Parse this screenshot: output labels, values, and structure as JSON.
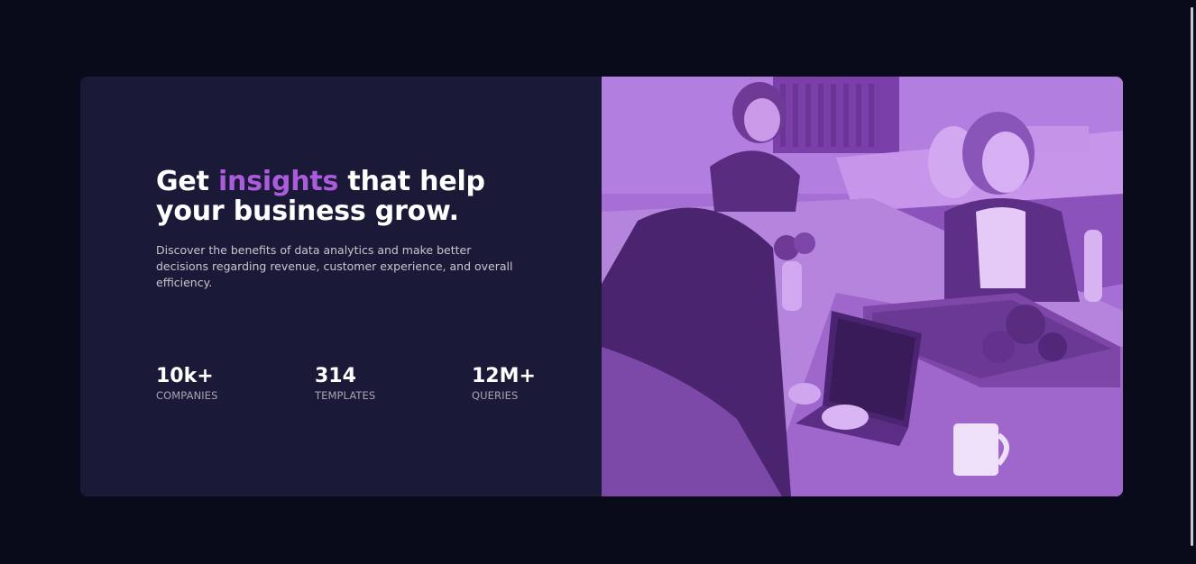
{
  "hero": {
    "headline_start": "Get ",
    "headline_accent": "insights",
    "headline_end": " that help your business grow.",
    "description": "Discover the benefits of data analytics and make better decisions regarding revenue, customer experience, and overall efficiency."
  },
  "stats": [
    {
      "value": "10k+",
      "label": "COMPANIES"
    },
    {
      "value": "314",
      "label": "TEMPLATES"
    },
    {
      "value": "12M+",
      "label": "QUERIES"
    }
  ],
  "image": {
    "subject": "people working at laptops in an office, purple tint"
  },
  "colors": {
    "page_background": "#090b1a",
    "card_background": "#1b1938",
    "accent": "#ab5cdb",
    "image_overlay": "#a76ed8"
  }
}
